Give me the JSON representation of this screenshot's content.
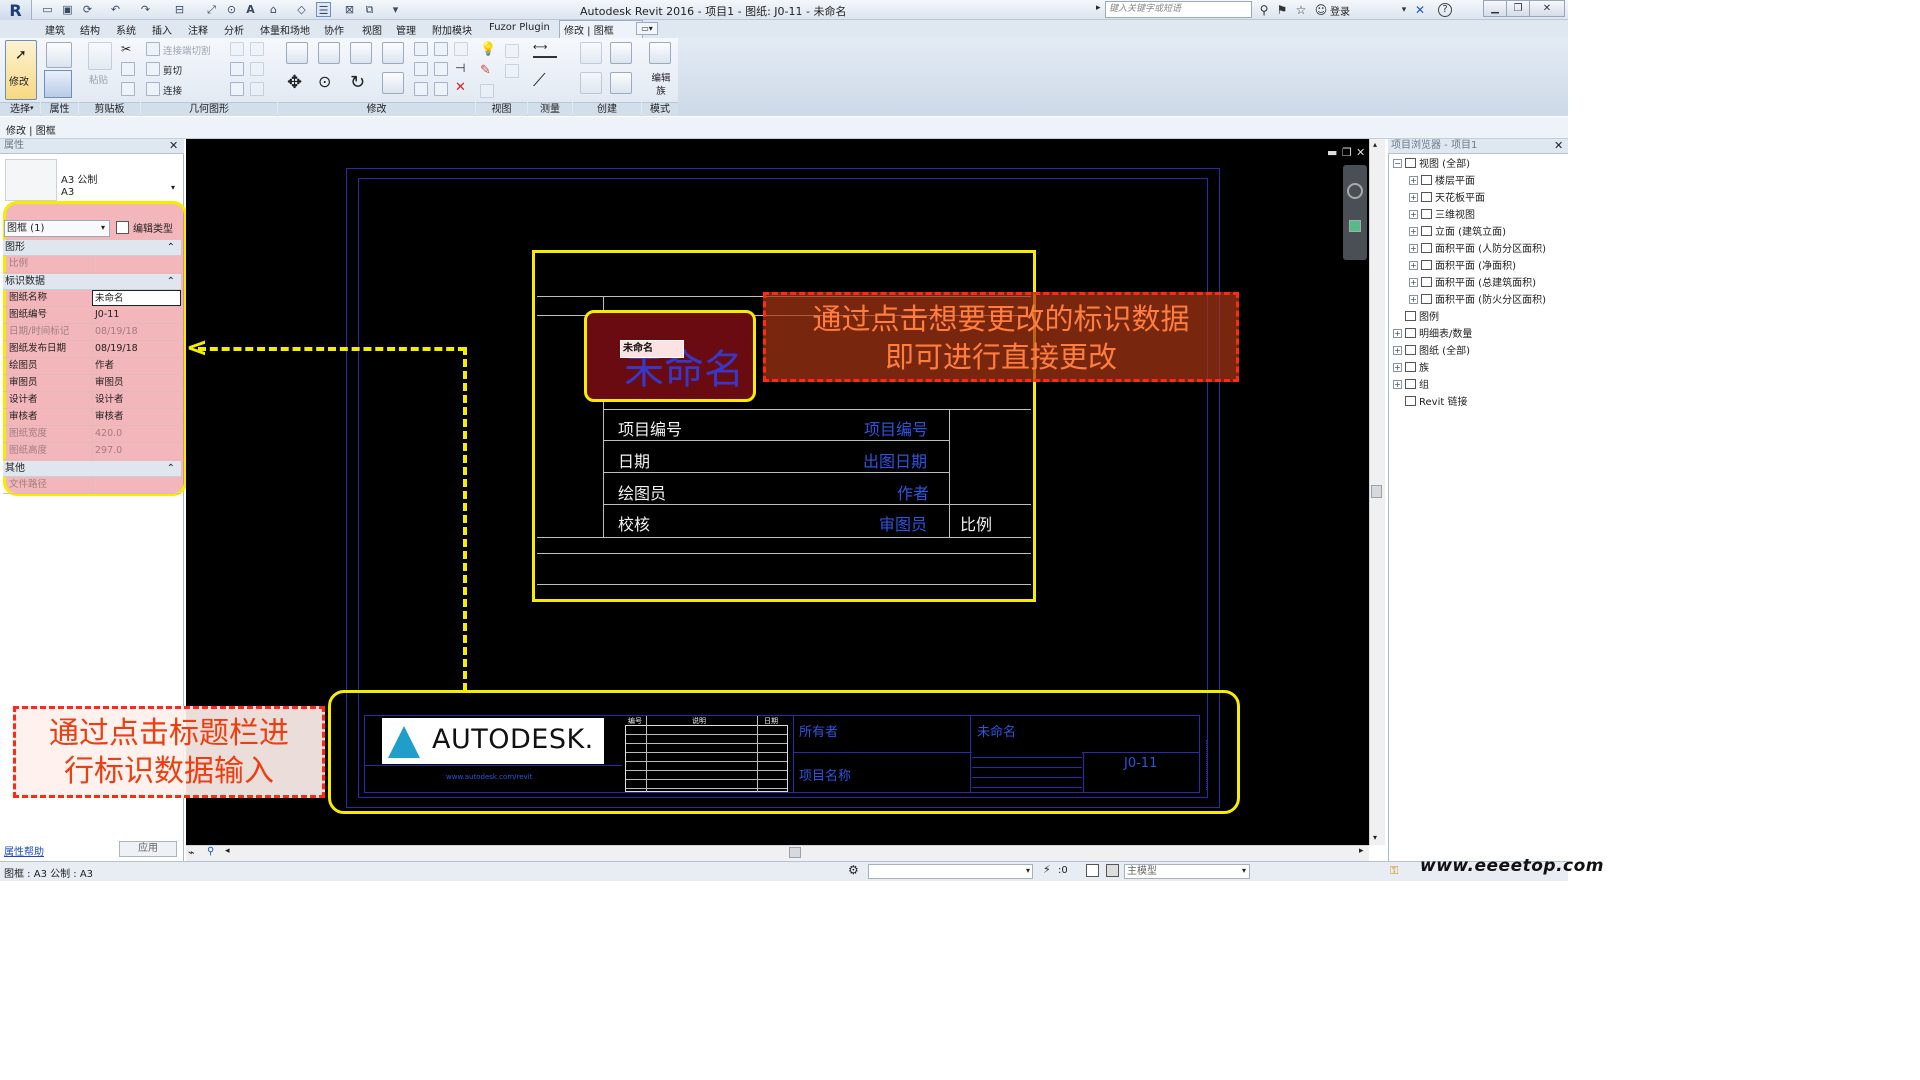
{
  "app": {
    "title": "Autodesk Revit 2016 -    项目1 - 图纸: J0-11 - 未命名",
    "search_placeholder": "键入关键字或短语",
    "login": "登录",
    "app_button": "R"
  },
  "tabs": [
    "建筑",
    "结构",
    "系统",
    "插入",
    "注释",
    "分析",
    "体量和场地",
    "协作",
    "视图",
    "管理",
    "附加模块",
    "Fuzor Plugin",
    "修改 | 图框"
  ],
  "ribbon": {
    "panels": [
      "选择",
      "属性",
      "剪贴板",
      "几何图形",
      "修改",
      "视图",
      "测量",
      "创建",
      "模式"
    ],
    "modify": "修改",
    "paste": "粘贴",
    "cut_join": "连接端切割",
    "cut": "剪切",
    "join": "连接",
    "edit_family": "编辑族"
  },
  "context_bar": "修改 | 图框",
  "properties": {
    "header": "属性",
    "type_line1": "A3 公制",
    "type_line2": "A3",
    "instance_select": "图框 (1)",
    "edit_type": "编辑类型",
    "groups": {
      "graphics": "图形",
      "identity": "标识数据",
      "other": "其他"
    },
    "scale_label": "比例",
    "rows": [
      {
        "k": "图纸名称",
        "v": "未命名",
        "ro": false
      },
      {
        "k": "图纸编号",
        "v": "J0-11",
        "ro": false
      },
      {
        "k": "日期/时间标记",
        "v": "08/19/18",
        "ro": true
      },
      {
        "k": "图纸发布日期",
        "v": "08/19/18",
        "ro": false
      },
      {
        "k": "绘图员",
        "v": "作者",
        "ro": false
      },
      {
        "k": "审图员",
        "v": "审图员",
        "ro": false
      },
      {
        "k": "设计者",
        "v": "设计者",
        "ro": false
      },
      {
        "k": "审核者",
        "v": "审核者",
        "ro": false
      },
      {
        "k": "图纸宽度",
        "v": "420.0",
        "ro": true
      },
      {
        "k": "图纸高度",
        "v": "297.0",
        "ro": true
      }
    ],
    "file_path_label": "文件路径",
    "help": "属性帮助",
    "apply": "应用"
  },
  "sheet": {
    "name_big": "未命名",
    "name_edit": "未命名",
    "rows": [
      {
        "k": "项目编号",
        "v": "项目编号"
      },
      {
        "k": "日期",
        "v": "出图日期"
      },
      {
        "k": "绘图员",
        "v": "作者"
      },
      {
        "k": "校核",
        "v": "审图员"
      }
    ],
    "scale": "比例",
    "logo": "AUTODESK.",
    "logo_url": "www.autodesk.com/revit",
    "rev_headers": [
      "编号",
      "说明",
      "日期"
    ],
    "owner": "所有者",
    "project_name": "项目名称",
    "sheet_name": "未命名",
    "sheet_number": "J0-11"
  },
  "callouts": {
    "right_line1": "通过点击想要更改的标识数据",
    "right_line2": "即可进行直接更改",
    "left_line1": "通过点击标题栏进",
    "left_line2": "行标识数据输入"
  },
  "browser": {
    "header": "项目浏览器 - 项目1",
    "nodes": [
      {
        "label": "视图 (全部)",
        "level": 0,
        "toggle": "⊟"
      },
      {
        "label": "楼层平面",
        "level": 1,
        "toggle": "⊞"
      },
      {
        "label": "天花板平面",
        "level": 1,
        "toggle": "⊞"
      },
      {
        "label": "三维视图",
        "level": 1,
        "toggle": "⊞"
      },
      {
        "label": "立面 (建筑立面)",
        "level": 1,
        "toggle": "⊞"
      },
      {
        "label": "面积平面 (人防分区面积)",
        "level": 1,
        "toggle": "⊞"
      },
      {
        "label": "面积平面 (净面积)",
        "level": 1,
        "toggle": "⊞"
      },
      {
        "label": "面积平面 (总建筑面积)",
        "level": 1,
        "toggle": "⊞"
      },
      {
        "label": "面积平面 (防火分区面积)",
        "level": 1,
        "toggle": "⊞"
      },
      {
        "label": "图例",
        "level": 0,
        "toggle": ""
      },
      {
        "label": "明细表/数量",
        "level": 0,
        "toggle": "⊞"
      },
      {
        "label": "图纸 (全部)",
        "level": 0,
        "toggle": "⊞"
      },
      {
        "label": "族",
        "level": 0,
        "toggle": "⊞"
      },
      {
        "label": "组",
        "level": 0,
        "toggle": "⊞"
      },
      {
        "label": "Revit 链接",
        "level": 0,
        "toggle": ""
      }
    ]
  },
  "status": {
    "text": "图框 : A3 公制 : A3",
    "zero": ":0",
    "model": "主模型"
  },
  "watermark": "www.eeeetop.com"
}
